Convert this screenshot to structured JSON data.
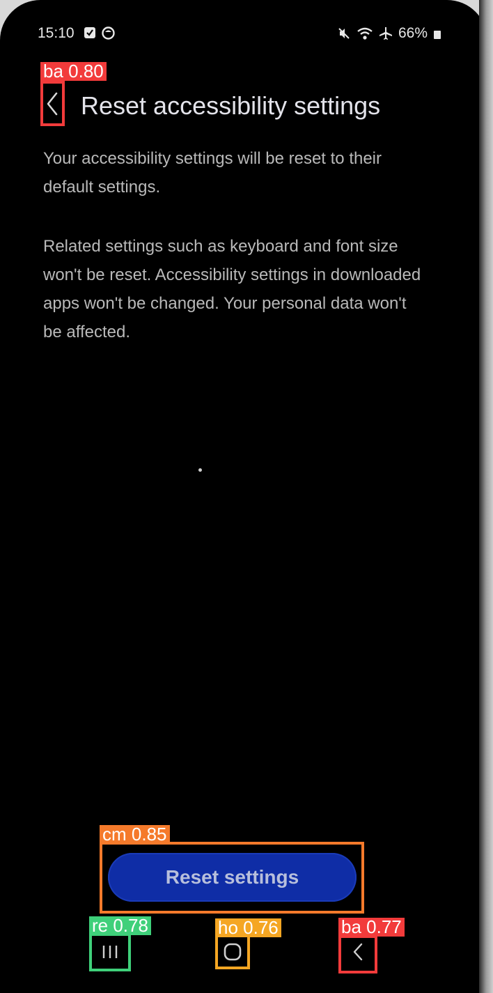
{
  "status_bar": {
    "time": "15:10",
    "battery": "66%",
    "left_icons": [
      "checkbox-notification-icon",
      "circle-app-icon"
    ],
    "right_icons": [
      "mute-icon",
      "wifi-icon",
      "airplane-icon",
      "battery-icon"
    ]
  },
  "header": {
    "title": "Reset accessibility settings",
    "back_icon": "chevron-left-icon"
  },
  "content": {
    "paragraph_1": "Your accessibility settings will be reset to their default settings.",
    "paragraph_2": "Related settings such as keyboard and font size won't be reset. Accessibility settings in downloaded apps won't be changed. Your personal data won't be affected."
  },
  "actions": {
    "reset_label": "Reset settings"
  },
  "nav_bar": {
    "recents_icon": "recents-icon",
    "home_icon": "home-icon",
    "back_icon": "back-icon"
  },
  "detections": [
    {
      "label": "ba 0.80",
      "color": "#f23b3b"
    },
    {
      "label": "cm 0.85",
      "color": "#f57a2b"
    },
    {
      "label": "re 0.78",
      "color": "#3fd07a"
    },
    {
      "label": "ho 0.76",
      "color": "#f5a623"
    },
    {
      "label": "ba 0.77",
      "color": "#f23b3b"
    }
  ],
  "colors": {
    "background": "#000000",
    "button": "#0f2da6",
    "text": "#b9b9b9"
  }
}
